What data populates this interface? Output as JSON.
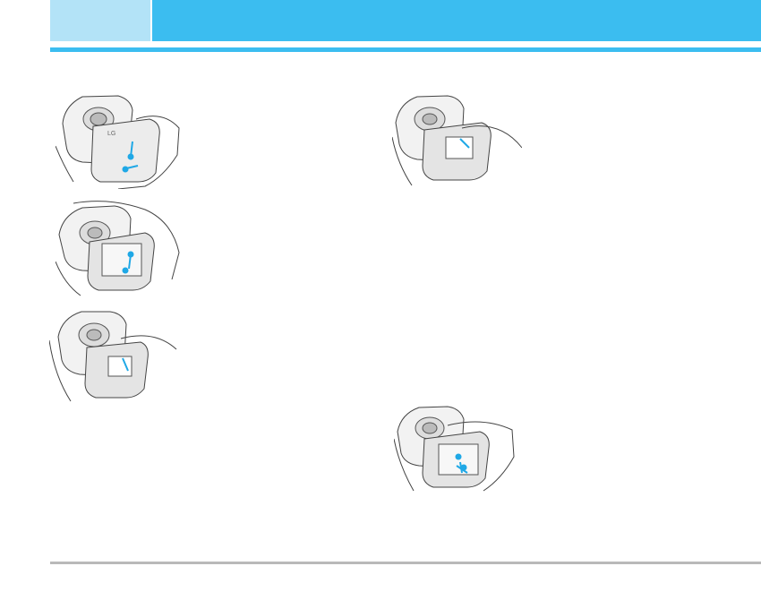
{
  "theme": {
    "accent": "#3bbdf0",
    "accent_light": "#b3e3f7",
    "rule_gray": "#b9b9b9",
    "arrow_blue": "#1fa8e6"
  },
  "illustrations": [
    {
      "id": "remove-back-cover",
      "icon": "phone-back-cover-illustration",
      "brand_mark": "LG"
    },
    {
      "id": "lift-battery",
      "icon": "battery-lift-illustration"
    },
    {
      "id": "slide-sim",
      "icon": "sim-slide-illustration"
    },
    {
      "id": "insert-sim",
      "icon": "sim-insert-illustration"
    },
    {
      "id": "insert-battery",
      "icon": "battery-insert-illustration"
    }
  ]
}
